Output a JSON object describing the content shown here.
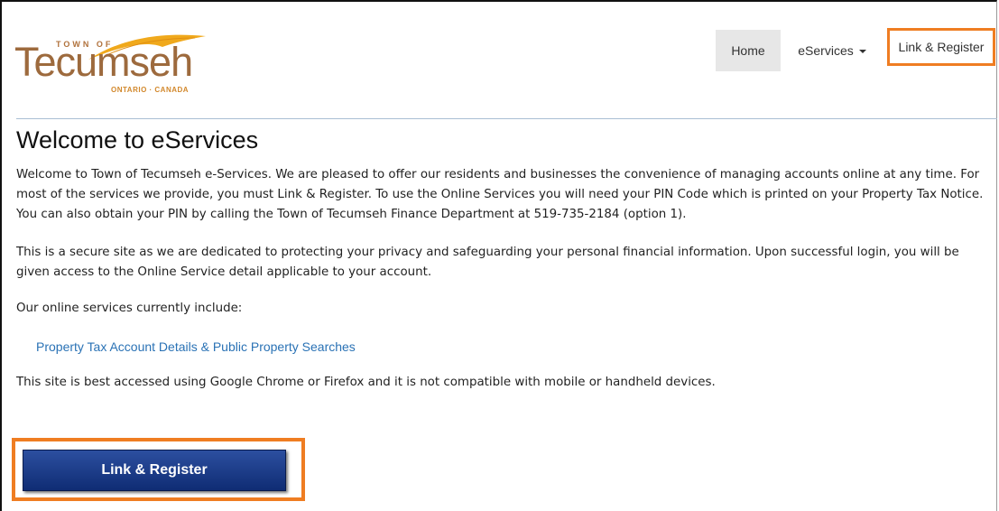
{
  "header": {
    "logo": {
      "town_of": "TOWN OF",
      "name": "Tecumseh",
      "region": "ONTARIO · CANADA"
    },
    "nav": {
      "home": "Home",
      "eservices": "eServices",
      "link_register": "Link & Register"
    }
  },
  "main": {
    "title": "Welcome to eServices",
    "intro": "Welcome to Town of Tecumseh e-Services.  We are pleased to offer our residents and businesses the convenience of managing accounts online at any time.  For most of the services we provide, you must Link & Register.  To use the Online Services you will need your PIN Code which is printed on your Property Tax Notice.  You can also obtain your PIN by calling the Town of Tecumseh Finance Department at 519-735-2184 (option 1).",
    "security": "This is a secure site as we are dedicated to protecting your privacy and safeguarding your personal financial information.  Upon successful login, you will be given access to the Online Service detail applicable to your account.",
    "services_intro": "Our online services currently include:",
    "services": [
      "Property Tax Account Details & Public Property Searches"
    ],
    "browser_note": "This site is best accessed using Google Chrome or Firefox and it is not compatible with mobile or handheld devices.",
    "cta_label": "Link & Register"
  },
  "colors": {
    "highlight_outline": "#ef7d22",
    "link": "#2a72b5",
    "button": "#1a3a88",
    "logo_text": "#9d6a3d",
    "logo_feather": "#f0a91c"
  }
}
